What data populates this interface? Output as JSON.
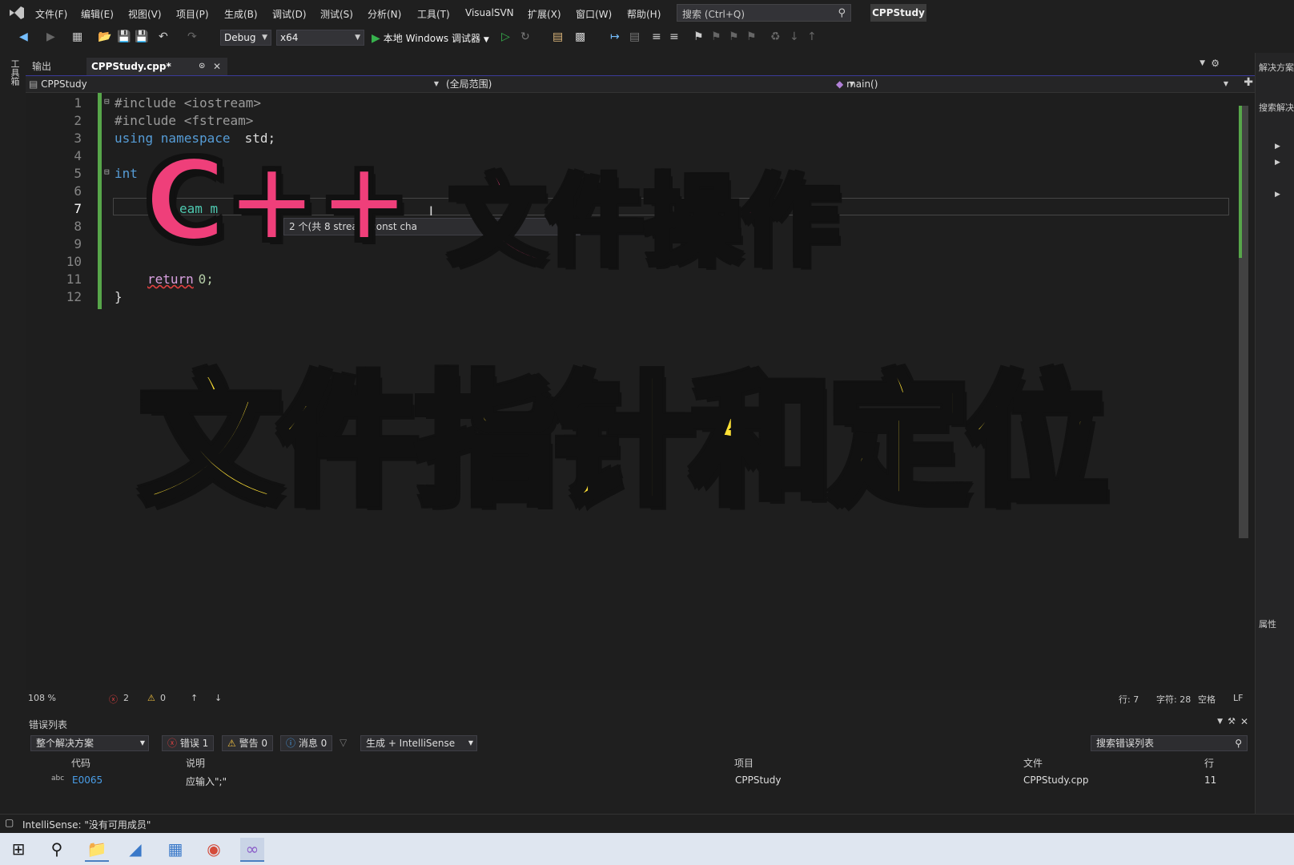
{
  "menubar": {
    "items": [
      "文件(F)",
      "编辑(E)",
      "视图(V)",
      "项目(P)",
      "生成(B)",
      "调试(D)",
      "测试(S)",
      "分析(N)",
      "工具(T)",
      "VisualSVN",
      "扩展(X)",
      "窗口(W)",
      "帮助(H)"
    ],
    "search_placeholder": "搜索 (Ctrl+Q)",
    "solution_name": "CPPStudy"
  },
  "toolbar": {
    "config": "Debug",
    "platform": "x64",
    "run_label": "本地 Windows 调试器"
  },
  "left_strip": {
    "label": "工具箱"
  },
  "tabs": [
    {
      "label": "输出"
    },
    {
      "label": "CPPStudy.cpp*"
    }
  ],
  "navbar": {
    "project": "CPPStudy",
    "scope": "(全局范围)",
    "member": "main()"
  },
  "editor": {
    "line_numbers": [
      "1",
      "2",
      "3",
      "4",
      "5",
      "6",
      "7",
      "8",
      "9",
      "10",
      "11",
      "12"
    ],
    "lines": {
      "l1": "#include <iostream>",
      "l2": "#include <fstream>",
      "l3a": "using namespace",
      "l3b": " std;",
      "l5": "int",
      "l7": "eam m",
      "l11a": "return",
      "l11b": " 0;",
      "l12": "}"
    },
    "tooltip": "2 个(共 8      stream(const cha"
  },
  "overlay": {
    "title_cpp": "C++",
    "title_fileop": "文件操作",
    "title_main": "文件指针和定位"
  },
  "editor_status": {
    "zoom": "108 %",
    "errors": "2",
    "warnings": "0",
    "line": "行: 7",
    "char": "字符: 28",
    "space": "空格",
    "eol": "LF"
  },
  "error_list": {
    "title": "错误列表",
    "scope": "整个解决方案",
    "errors_chip": "错误 1",
    "warnings_chip": "警告 0",
    "messages_chip": "消息 0",
    "build_filter": "生成 + IntelliSense",
    "search_placeholder": "搜索错误列表",
    "columns": [
      "代码",
      "说明",
      "项目",
      "文件",
      "行"
    ],
    "rows": [
      {
        "code": "E0065",
        "desc": "应输入\";\"",
        "project": "CPPStudy",
        "file": "CPPStudy.cpp",
        "line": "11"
      }
    ]
  },
  "right_panel": {
    "solution_label": "解决方案",
    "search_label": "搜索解决",
    "props_label": "属性"
  },
  "statusbar": {
    "text": "IntelliSense: \"没有可用成员\""
  },
  "colors": {
    "accent": "#3b3b9a",
    "pink": "#ef3f7a",
    "yellow": "#ffe135",
    "green": "#57a64a"
  }
}
